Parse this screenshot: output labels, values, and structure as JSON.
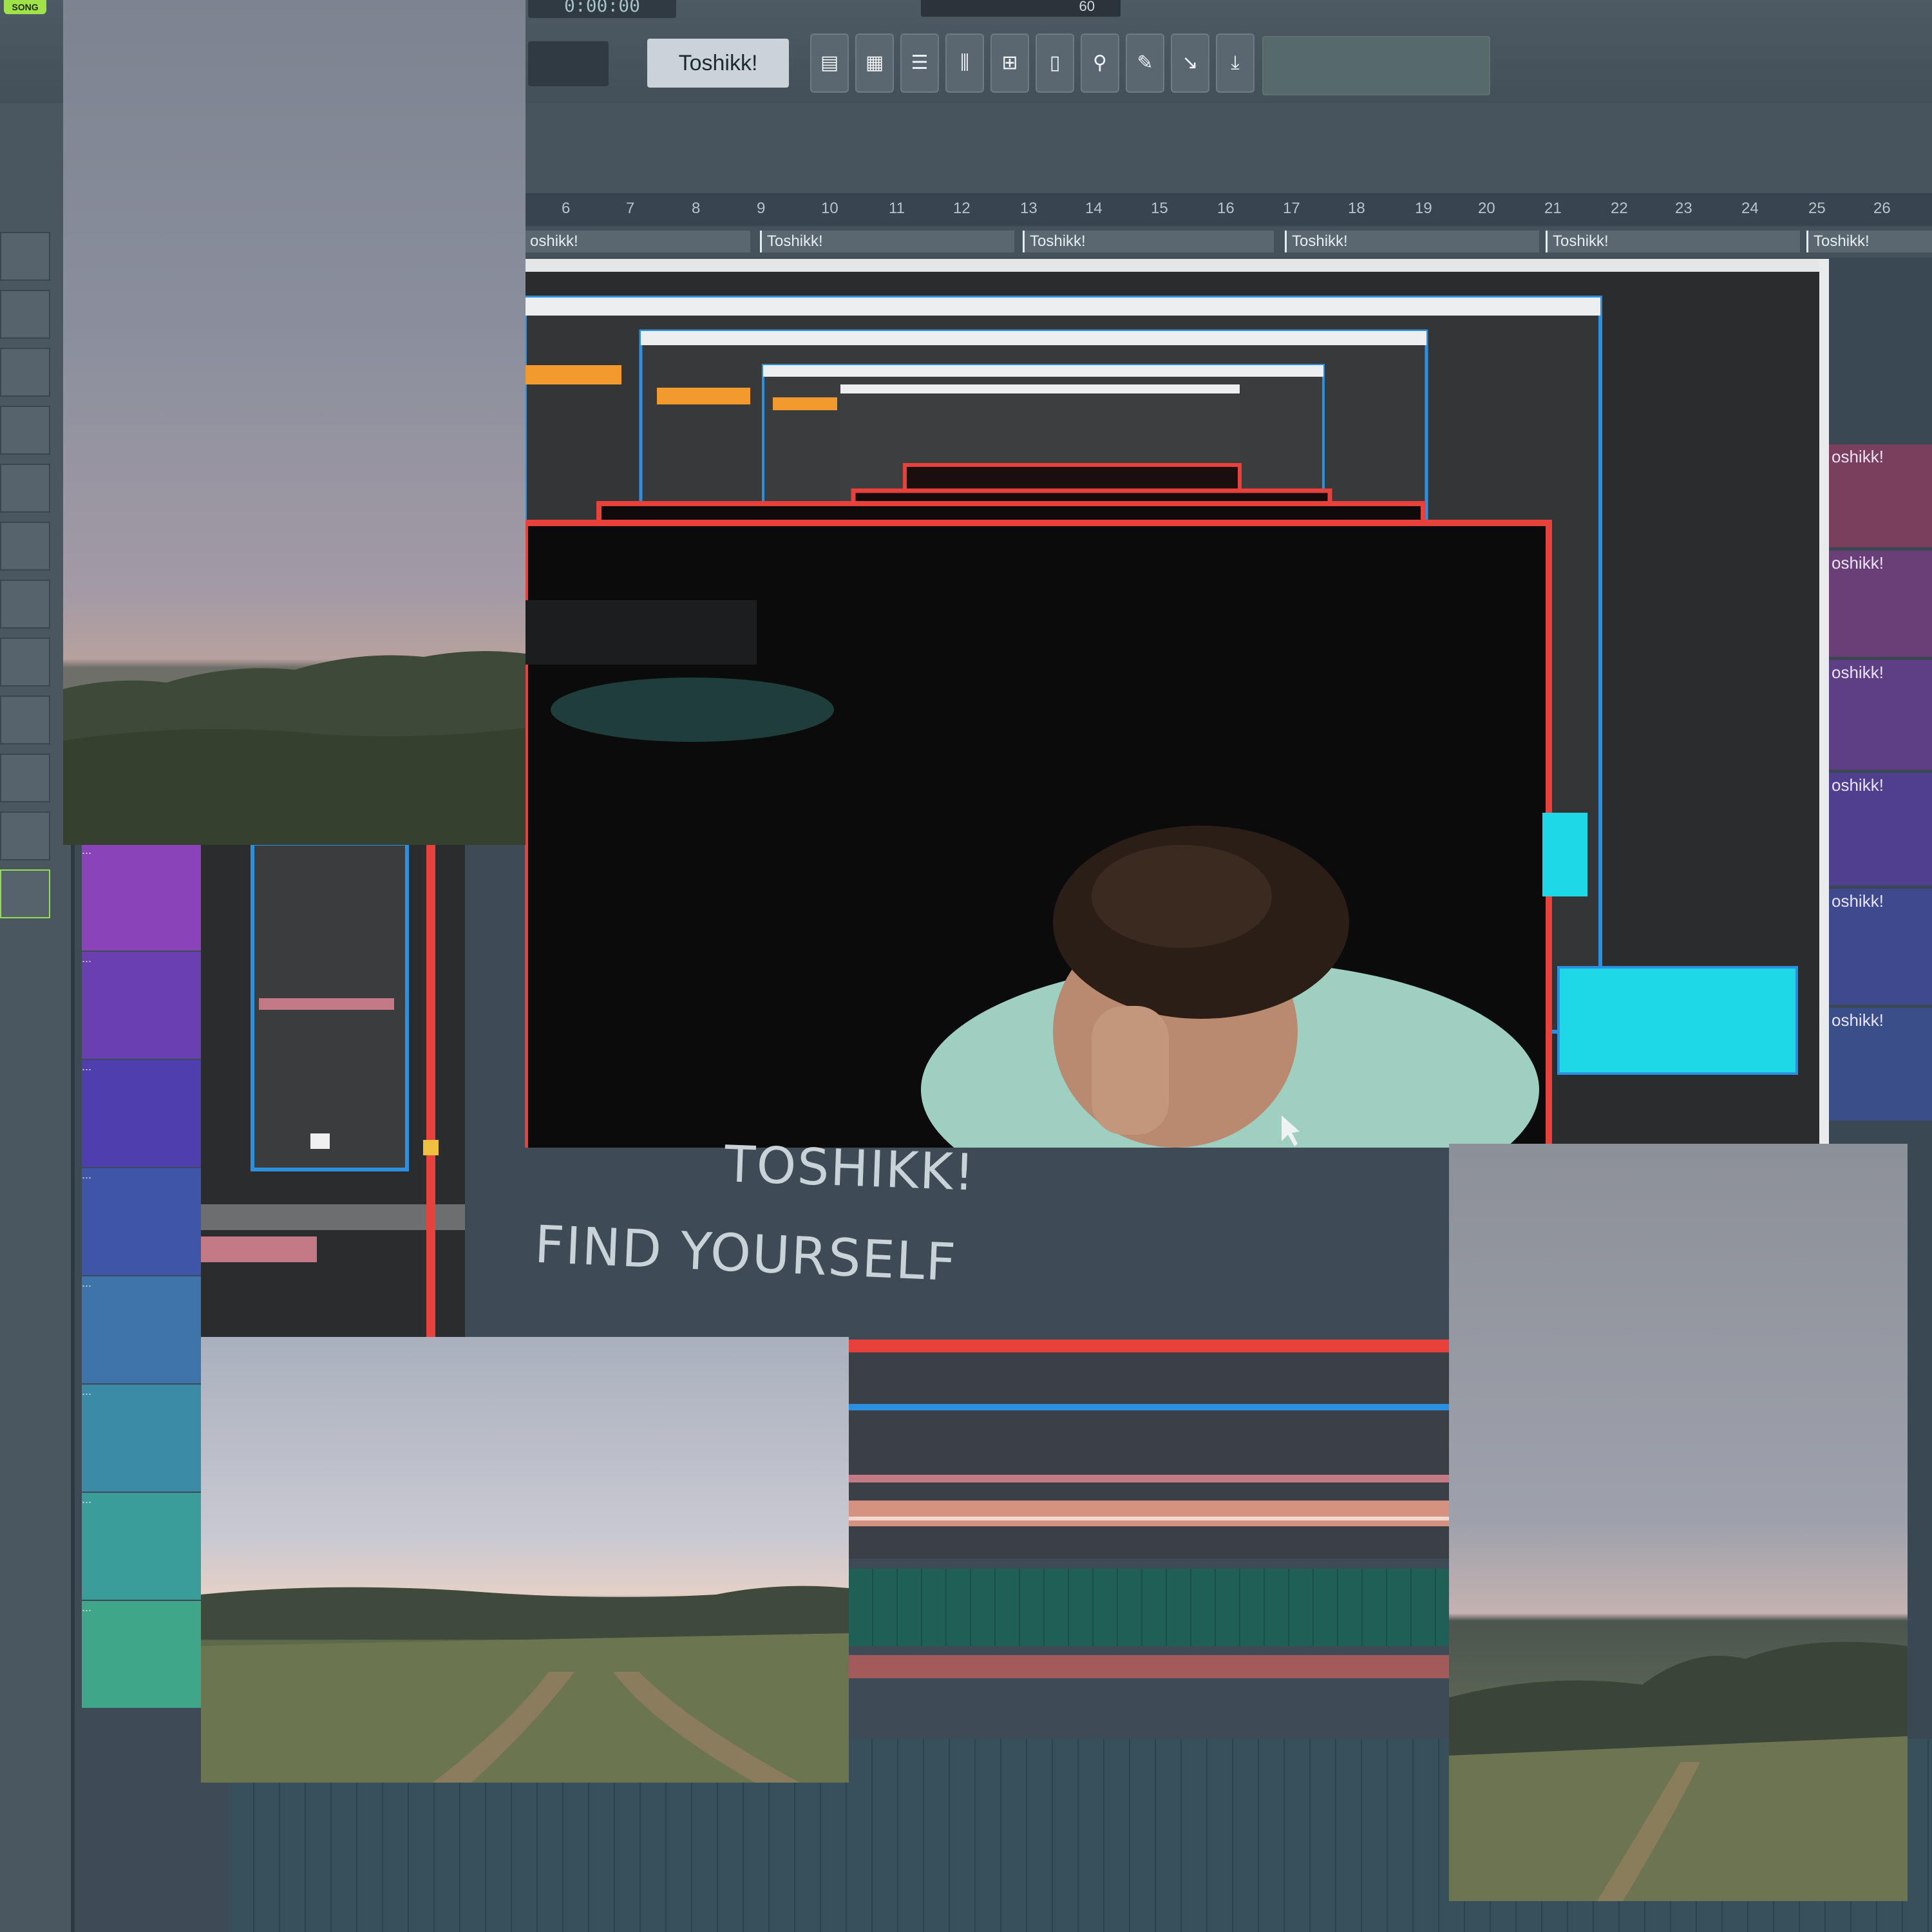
{
  "daw": {
    "mode_button": "SONG",
    "time_display": "0:00:00",
    "tempo_value": "60",
    "pattern_name": "Toshikk!",
    "ruler_ticks": [
      "6",
      "7",
      "8",
      "9",
      "10",
      "11",
      "12",
      "13",
      "14",
      "15",
      "16",
      "17",
      "18",
      "19",
      "20",
      "21",
      "22",
      "23",
      "24",
      "25",
      "26"
    ],
    "clip_labels": [
      "oshikk!",
      "Toshikk!",
      "Toshikk!",
      "Toshikk!",
      "Toshikk!",
      "Toshikk!"
    ],
    "right_track_labels": [
      "oshikk!",
      "oshikk!",
      "oshikk!",
      "oshikk!",
      "oshikk!",
      "oshikk!"
    ],
    "toolbar_icons": [
      "playlist-icon",
      "step-sequencer-icon",
      "piano-roll-icon",
      "mixer-icon",
      "channel-rack-icon",
      "browser-icon",
      "plugin-icon",
      "wizard-icon",
      "export-icon",
      "download-icon"
    ],
    "track_dots": "..."
  },
  "cover": {
    "title": "TOSHIKK!",
    "subtitle": "FIND YOURSELF"
  },
  "colors": {
    "track_colors": [
      "#8a43b8",
      "#6a3fb0",
      "#4f3fae",
      "#3f55a8",
      "#3f74aa",
      "#3b8aa6",
      "#3a9d9a",
      "#3fa68a",
      "#46a47a"
    ],
    "accent_red": "#e8403a",
    "accent_blue": "#2d8fe0",
    "accent_cyan": "#1ed8e8"
  }
}
